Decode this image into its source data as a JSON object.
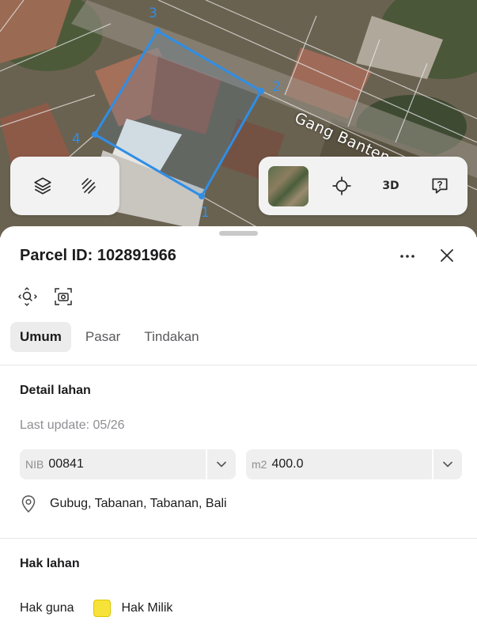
{
  "map": {
    "street_name": "Gang Banteng",
    "parcel_color": "#2f8ee6",
    "vertices": [
      "1",
      "2",
      "3",
      "4"
    ]
  },
  "map_controls": {
    "left": [
      "layers-icon",
      "measure-icon"
    ],
    "right": [
      "basemap-thumbnail",
      "locate-icon",
      "3d-toggle",
      "feedback-icon"
    ],
    "three_d_label": "3D"
  },
  "sheet": {
    "title": "Parcel ID: 102891966",
    "tools": [
      "zoom-to-parcel-icon",
      "screenshot-icon"
    ],
    "tabs": [
      {
        "label": "Umum",
        "active": true
      },
      {
        "label": "Pasar",
        "active": false
      },
      {
        "label": "Tindakan",
        "active": false
      }
    ],
    "detail": {
      "heading": "Detail lahan",
      "last_update": "Last update: 05/26",
      "nib": {
        "prefix": "NIB",
        "value": "00841"
      },
      "area": {
        "prefix": "m2",
        "value": "400.0"
      },
      "location": "Gubug, Tabanan, Tabanan, Bali"
    },
    "rights": {
      "heading": "Hak lahan",
      "label": "Hak guna",
      "value": "Hak Milik",
      "swatch_color": "#f7e23a"
    }
  }
}
